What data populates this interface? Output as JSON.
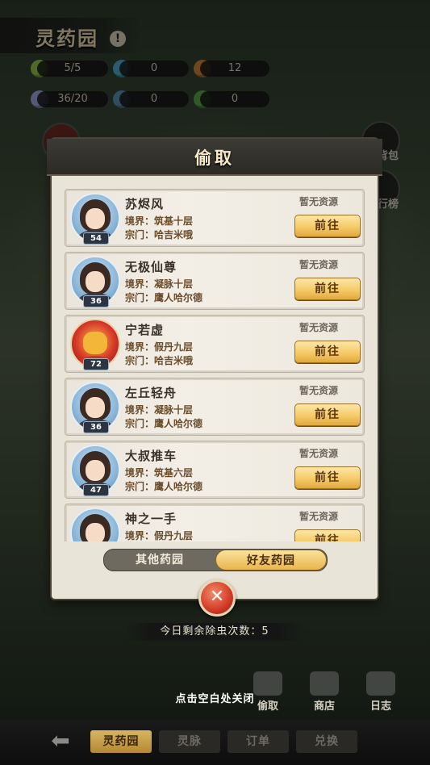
{
  "header": {
    "title": "灵药园",
    "info": "!"
  },
  "resources": [
    {
      "value": "5/5"
    },
    {
      "value": "0"
    },
    {
      "value": "12"
    },
    {
      "value": "36/20"
    },
    {
      "value": "0"
    },
    {
      "value": "0"
    }
  ],
  "side_labels": {
    "bag": "背包",
    "rank": "行榜"
  },
  "modal": {
    "title": "偷取",
    "players": [
      {
        "name": "苏烬风",
        "level": "54",
        "realm": "境界：筑基十层",
        "sect": "宗门：哈吉米哦",
        "status": "暂无资源",
        "button": "前往"
      },
      {
        "name": "无极仙尊",
        "level": "36",
        "realm": "境界：凝脉十层",
        "sect": "宗门：鹰人哈尔德",
        "status": "暂无资源",
        "button": "前往"
      },
      {
        "name": "宁若虚",
        "level": "72",
        "realm": "境界：假丹九层",
        "sect": "宗门：哈吉米哦",
        "status": "暂无资源",
        "button": "前往"
      },
      {
        "name": "左丘轻舟",
        "level": "36",
        "realm": "境界：凝脉十层",
        "sect": "宗门：鹰人哈尔德",
        "status": "暂无资源",
        "button": "前往"
      },
      {
        "name": "大叔推车",
        "level": "47",
        "realm": "境界：筑基六层",
        "sect": "宗门：鹰人哈尔德",
        "status": "暂无资源",
        "button": "前往"
      },
      {
        "name": "神之一手",
        "level": "",
        "realm": "境界：假丹九层",
        "sect": "",
        "status": "暂无资源",
        "button": "前往"
      }
    ],
    "tabs": {
      "other": "其他药园",
      "friend": "好友药园",
      "selected": "好友药园"
    }
  },
  "remaining_label": "今日剩余除虫次数：5",
  "close_hint": "点击空白处关闭",
  "actions": [
    {
      "label": "偷取",
      "icon": "lotus-icon"
    },
    {
      "label": "商店",
      "icon": "shop-icon"
    },
    {
      "label": "日志",
      "icon": "log-icon"
    }
  ],
  "bottom_nav": [
    {
      "label": "灵药园",
      "active": true
    },
    {
      "label": "灵脉",
      "active": false
    },
    {
      "label": "订单",
      "active": false
    },
    {
      "label": "兑换",
      "active": false
    }
  ],
  "colors": {
    "accent_gold": "#f4c763",
    "modal_bg": "#e9e4d8",
    "close_red": "#d23a26"
  }
}
